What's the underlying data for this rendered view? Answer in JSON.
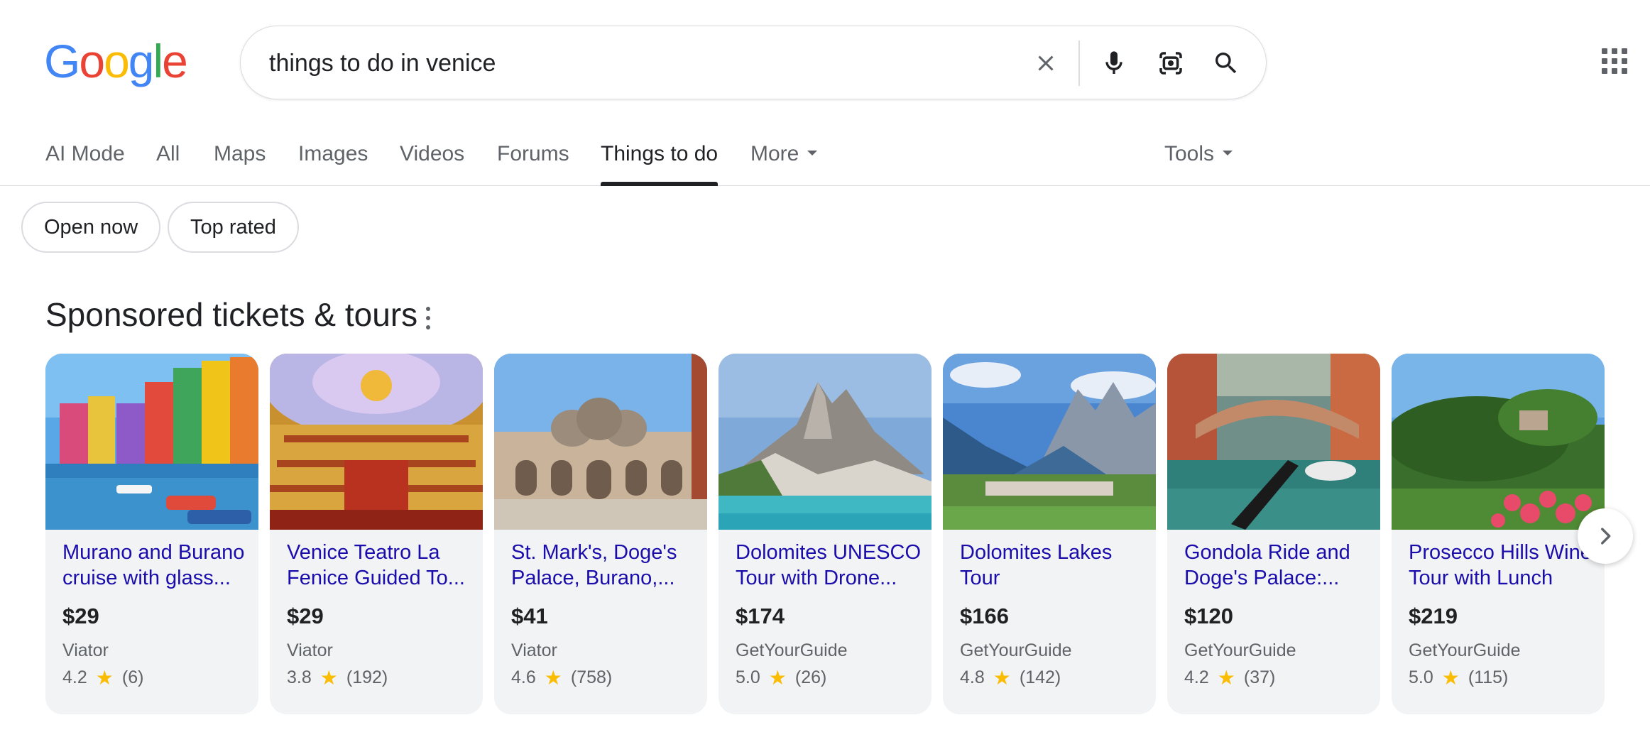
{
  "header": {
    "logo_letters": [
      "G",
      "o",
      "o",
      "g",
      "l",
      "e"
    ],
    "logo_colors": [
      "#4285F4",
      "#EA4335",
      "#FBBC05",
      "#4285F4",
      "#34A853",
      "#EA4335"
    ],
    "search_value": "things to do in venice",
    "icons": [
      "close-icon",
      "microphone-icon",
      "lens-icon",
      "search-icon",
      "apps-icon"
    ]
  },
  "tabs": {
    "ai_mode": "AI Mode",
    "all": "All",
    "maps": "Maps",
    "images": "Images",
    "videos": "Videos",
    "forums": "Forums",
    "things_to_do": "Things to do",
    "more": "More",
    "tools": "Tools",
    "active": "Things to do"
  },
  "chips": {
    "open_now": "Open now",
    "top_rated": "Top rated"
  },
  "section": {
    "title": "Sponsored tickets & tours"
  },
  "cards": [
    {
      "title": "Murano and Burano cruise with glass...",
      "price": "$29",
      "source": "Viator",
      "rating": "4.2",
      "reviews": "(6)"
    },
    {
      "title": "Venice Teatro La Fenice Guided To...",
      "price": "$29",
      "source": "Viator",
      "rating": "3.8",
      "reviews": "(192)"
    },
    {
      "title": "St. Mark's, Doge's Palace, Burano,...",
      "price": "$41",
      "source": "Viator",
      "rating": "4.6",
      "reviews": "(758)"
    },
    {
      "title": "Dolomites UNESCO Tour with Drone...",
      "price": "$174",
      "source": "GetYourGuide",
      "rating": "5.0",
      "reviews": "(26)"
    },
    {
      "title": "Dolomites Lakes Tour",
      "price": "$166",
      "source": "GetYourGuide",
      "rating": "4.8",
      "reviews": "(142)"
    },
    {
      "title": "Gondola Ride and Doge's Palace:...",
      "price": "$120",
      "source": "GetYourGuide",
      "rating": "4.2",
      "reviews": "(37)"
    },
    {
      "title": "Prosecco Hills Wine Tour with Lunch",
      "price": "$219",
      "source": "GetYourGuide",
      "rating": "5.0",
      "reviews": "(115)"
    }
  ],
  "colors": {
    "link": "#1a0dab",
    "star": "#fbbc04",
    "muted": "#5f6368",
    "card_bg": "#f1f3f4"
  }
}
